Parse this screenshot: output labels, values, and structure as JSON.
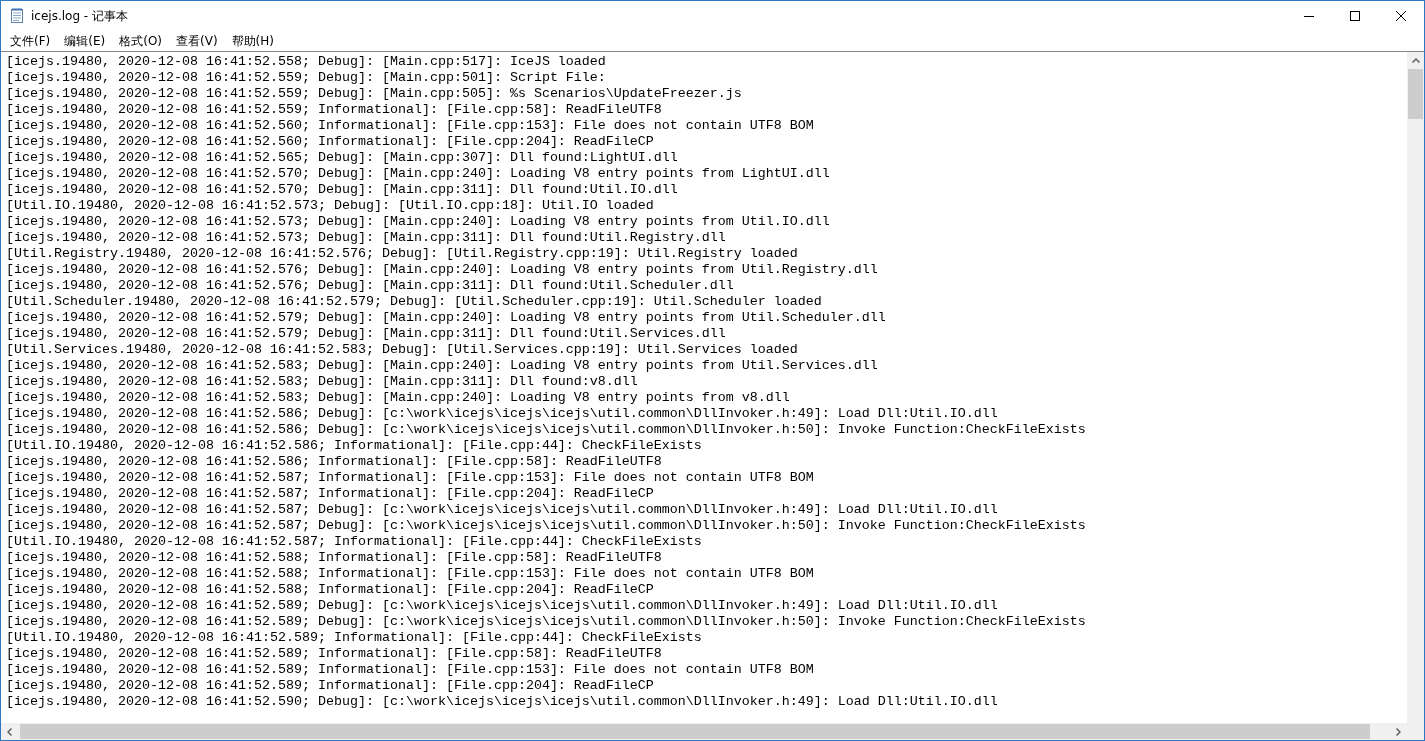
{
  "window": {
    "title": "icejs.log - 记事本"
  },
  "menu": [
    "文件(F)",
    "编辑(E)",
    "格式(O)",
    "查看(V)",
    "帮助(H)"
  ],
  "lines": [
    "[icejs.19480, 2020-12-08 16:41:52.558; Debug]: [Main.cpp:517]: IceJS loaded",
    "[icejs.19480, 2020-12-08 16:41:52.559; Debug]: [Main.cpp:501]: Script File:",
    "[icejs.19480, 2020-12-08 16:41:52.559; Debug]: [Main.cpp:505]: %s Scenarios\\UpdateFreezer.js",
    "[icejs.19480, 2020-12-08 16:41:52.559; Informational]: [File.cpp:58]: ReadFileUTF8",
    "[icejs.19480, 2020-12-08 16:41:52.560; Informational]: [File.cpp:153]: File does not contain UTF8 BOM",
    "[icejs.19480, 2020-12-08 16:41:52.560; Informational]: [File.cpp:204]: ReadFileCP",
    "[icejs.19480, 2020-12-08 16:41:52.565; Debug]: [Main.cpp:307]: Dll found:LightUI.dll",
    "[icejs.19480, 2020-12-08 16:41:52.570; Debug]: [Main.cpp:240]: Loading V8 entry points from LightUI.dll",
    "[icejs.19480, 2020-12-08 16:41:52.570; Debug]: [Main.cpp:311]: Dll found:Util.IO.dll",
    "[Util.IO.19480, 2020-12-08 16:41:52.573; Debug]: [Util.IO.cpp:18]: Util.IO loaded",
    "[icejs.19480, 2020-12-08 16:41:52.573; Debug]: [Main.cpp:240]: Loading V8 entry points from Util.IO.dll",
    "[icejs.19480, 2020-12-08 16:41:52.573; Debug]: [Main.cpp:311]: Dll found:Util.Registry.dll",
    "[Util.Registry.19480, 2020-12-08 16:41:52.576; Debug]: [Util.Registry.cpp:19]: Util.Registry loaded",
    "[icejs.19480, 2020-12-08 16:41:52.576; Debug]: [Main.cpp:240]: Loading V8 entry points from Util.Registry.dll",
    "[icejs.19480, 2020-12-08 16:41:52.576; Debug]: [Main.cpp:311]: Dll found:Util.Scheduler.dll",
    "[Util.Scheduler.19480, 2020-12-08 16:41:52.579; Debug]: [Util.Scheduler.cpp:19]: Util.Scheduler loaded",
    "[icejs.19480, 2020-12-08 16:41:52.579; Debug]: [Main.cpp:240]: Loading V8 entry points from Util.Scheduler.dll",
    "[icejs.19480, 2020-12-08 16:41:52.579; Debug]: [Main.cpp:311]: Dll found:Util.Services.dll",
    "[Util.Services.19480, 2020-12-08 16:41:52.583; Debug]: [Util.Services.cpp:19]: Util.Services loaded",
    "[icejs.19480, 2020-12-08 16:41:52.583; Debug]: [Main.cpp:240]: Loading V8 entry points from Util.Services.dll",
    "[icejs.19480, 2020-12-08 16:41:52.583; Debug]: [Main.cpp:311]: Dll found:v8.dll",
    "[icejs.19480, 2020-12-08 16:41:52.583; Debug]: [Main.cpp:240]: Loading V8 entry points from v8.dll",
    "[icejs.19480, 2020-12-08 16:41:52.586; Debug]: [c:\\work\\icejs\\icejs\\icejs\\util.common\\DllInvoker.h:49]: Load Dll:Util.IO.dll",
    "[icejs.19480, 2020-12-08 16:41:52.586; Debug]: [c:\\work\\icejs\\icejs\\icejs\\util.common\\DllInvoker.h:50]: Invoke Function:CheckFileExists",
    "[Util.IO.19480, 2020-12-08 16:41:52.586; Informational]: [File.cpp:44]: CheckFileExists",
    "[icejs.19480, 2020-12-08 16:41:52.586; Informational]: [File.cpp:58]: ReadFileUTF8",
    "[icejs.19480, 2020-12-08 16:41:52.587; Informational]: [File.cpp:153]: File does not contain UTF8 BOM",
    "[icejs.19480, 2020-12-08 16:41:52.587; Informational]: [File.cpp:204]: ReadFileCP",
    "[icejs.19480, 2020-12-08 16:41:52.587; Debug]: [c:\\work\\icejs\\icejs\\icejs\\util.common\\DllInvoker.h:49]: Load Dll:Util.IO.dll",
    "[icejs.19480, 2020-12-08 16:41:52.587; Debug]: [c:\\work\\icejs\\icejs\\icejs\\util.common\\DllInvoker.h:50]: Invoke Function:CheckFileExists",
    "[Util.IO.19480, 2020-12-08 16:41:52.587; Informational]: [File.cpp:44]: CheckFileExists",
    "[icejs.19480, 2020-12-08 16:41:52.588; Informational]: [File.cpp:58]: ReadFileUTF8",
    "[icejs.19480, 2020-12-08 16:41:52.588; Informational]: [File.cpp:153]: File does not contain UTF8 BOM",
    "[icejs.19480, 2020-12-08 16:41:52.588; Informational]: [File.cpp:204]: ReadFileCP",
    "[icejs.19480, 2020-12-08 16:41:52.589; Debug]: [c:\\work\\icejs\\icejs\\icejs\\util.common\\DllInvoker.h:49]: Load Dll:Util.IO.dll",
    "[icejs.19480, 2020-12-08 16:41:52.589; Debug]: [c:\\work\\icejs\\icejs\\icejs\\util.common\\DllInvoker.h:50]: Invoke Function:CheckFileExists",
    "[Util.IO.19480, 2020-12-08 16:41:52.589; Informational]: [File.cpp:44]: CheckFileExists",
    "[icejs.19480, 2020-12-08 16:41:52.589; Informational]: [File.cpp:58]: ReadFileUTF8",
    "[icejs.19480, 2020-12-08 16:41:52.589; Informational]: [File.cpp:153]: File does not contain UTF8 BOM",
    "[icejs.19480, 2020-12-08 16:41:52.589; Informational]: [File.cpp:204]: ReadFileCP",
    "[icejs.19480, 2020-12-08 16:41:52.590; Debug]: [c:\\work\\icejs\\icejs\\icejs\\util.common\\DllInvoker.h:49]: Load Dll:Util.IO.dll"
  ]
}
